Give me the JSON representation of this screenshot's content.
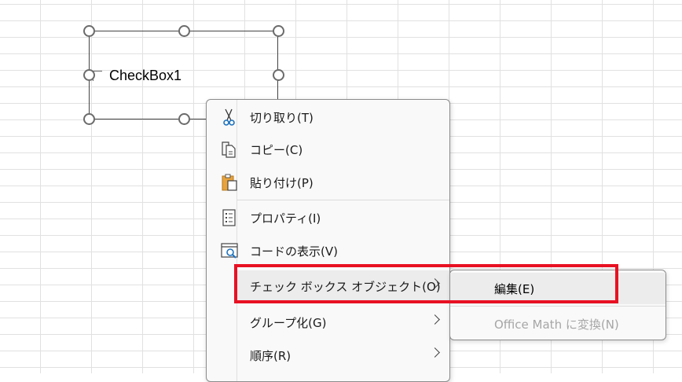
{
  "checkbox": {
    "label": "CheckBox1"
  },
  "context_menu": {
    "items": [
      {
        "label": "切り取り(T)",
        "icon": "scissors-icon"
      },
      {
        "label": "コピー(C)",
        "icon": "copy-icon"
      },
      {
        "label": "貼り付け(P)",
        "icon": "paste-icon"
      },
      {
        "label": "プロパティ(I)",
        "icon": "properties-icon"
      },
      {
        "label": "コードの表示(V)",
        "icon": "view-code-icon"
      },
      {
        "label": "チェック ボックス オブジェクト(O)",
        "icon": "",
        "submenu": true
      },
      {
        "label": "グループ化(G)",
        "icon": "",
        "submenu": true
      },
      {
        "label": "順序(R)",
        "icon": "",
        "submenu": true
      }
    ]
  },
  "submenu": {
    "items": [
      {
        "label": "編集(E)",
        "enabled": true
      },
      {
        "label": "Office Math に変換(N)",
        "enabled": false
      }
    ]
  },
  "colors": {
    "highlight_border": "#e81123",
    "menu_background": "#f9f9f9",
    "hover_background": "#ececec"
  }
}
